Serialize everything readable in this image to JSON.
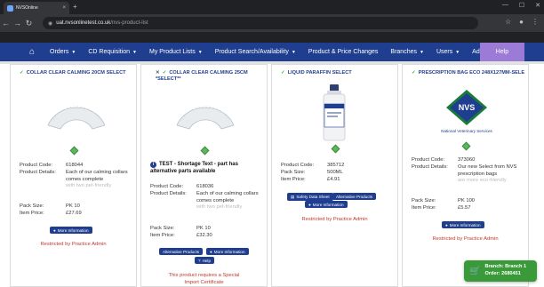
{
  "browser": {
    "tab_title": "NVSOnline",
    "tab_close": "×",
    "new_tab": "+",
    "url_domain": "uat.nvsonlinetest.co.uk",
    "url_path": "/nvs-product-list",
    "win_min": "—",
    "win_max": "☐",
    "win_close": "✕"
  },
  "nav": {
    "items": [
      {
        "label": "Orders",
        "caret": true
      },
      {
        "label": "CD Requisition",
        "caret": true
      },
      {
        "label": "My Product Lists",
        "caret": true
      },
      {
        "label": "Product Search/Availability",
        "caret": true
      },
      {
        "label": "Product & Price Changes",
        "caret": false
      },
      {
        "label": "Branches",
        "caret": true
      },
      {
        "label": "Users",
        "caret": true
      },
      {
        "label": "Additional",
        "caret": true
      }
    ],
    "help": "Help"
  },
  "products": [
    {
      "title": "COLLAR CLEAR CALMING 20CM SELECT",
      "code_label": "Product Code:",
      "code": "618044",
      "details_label": "Product Details:",
      "details": "Each of our calming collars comes complete",
      "details_faded": "with two pet-friendly",
      "pack_label": "Pack Size:",
      "pack": "PK 10",
      "price_label": "Item Price:",
      "price": "£27.69",
      "more_btn": "More Information",
      "restricted": "Restricted by Practice Admin"
    },
    {
      "title": "COLLAR CLEAR CALMING 25CM *SELECT**",
      "warning": "TEST - Shortage Text - part has alternative parts available",
      "code_label": "Product Code:",
      "code": "618036",
      "details_label": "Product Details:",
      "details": "Each of our calming collars comes complete",
      "details_faded": "with two pet-friendly",
      "pack_label": "Pack Size:",
      "pack": "PK 10",
      "price_label": "Item Price:",
      "price": "£32.30",
      "alt_btn": "Alternative Products",
      "more_btn": "More Information",
      "help_btn": "Help",
      "special": "This product requires a Special Import Certificate"
    },
    {
      "title": "LIQUID PARAFFIN SELECT",
      "code_label": "Product Code:",
      "code": "385712",
      "pack_label": "Pack Size:",
      "pack": "500ML",
      "price_label": "Item Price:",
      "price": "£4.91",
      "sds_btn": "Safety Data Sheet",
      "alt_btn": "Alternative Products",
      "more_btn": "More Information",
      "restricted": "Restricted by Practice Admin"
    },
    {
      "title": "PRESCRIPTION BAG ECO 248X127MM-SELE",
      "logo_text": "NVS",
      "logo_caption": "National Veterinary Services",
      "code_label": "Product Code:",
      "code": "373060",
      "details_label": "Product Details:",
      "details": "Our new Select from NVS prescription bags",
      "details_faded": "are more eco-friendly",
      "pack_label": "Pack Size:",
      "pack": "PK 100",
      "price_label": "Item Price:",
      "price": "£5.57",
      "more_btn": "More Information",
      "restricted": "Restricted by Practice Admin"
    }
  ],
  "branch": {
    "line1": "Branch: Branch 1",
    "line2": "Order: 2680451"
  },
  "colors": {
    "nav_bg": "#1f3e8f",
    "help_bg": "#9b7bd6",
    "restricted": "#c0392b",
    "branch_bg": "#3a9a3a",
    "stock_ok": "#5cb85c"
  }
}
